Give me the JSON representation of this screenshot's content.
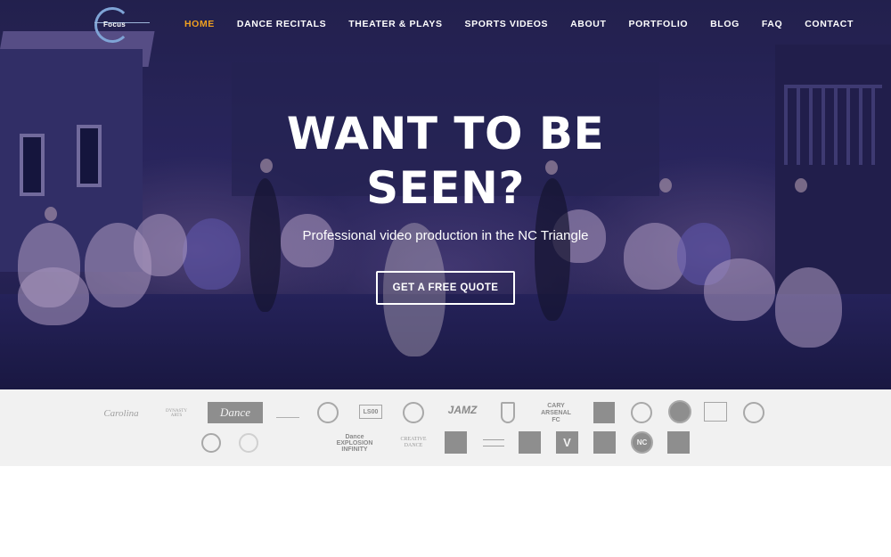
{
  "nav": {
    "logo_word": "Focus",
    "items": [
      {
        "label": "HOME",
        "active": true
      },
      {
        "label": "DANCE RECITALS",
        "active": false
      },
      {
        "label": "THEATER & PLAYS",
        "active": false
      },
      {
        "label": "SPORTS VIDEOS",
        "active": false
      },
      {
        "label": "ABOUT",
        "active": false
      },
      {
        "label": "PORTFOLIO",
        "active": false
      },
      {
        "label": "BLOG",
        "active": false
      },
      {
        "label": "FAQ",
        "active": false
      },
      {
        "label": "CONTACT",
        "active": false
      }
    ],
    "active_color": "#f0a020"
  },
  "hero": {
    "title_line1": "WANT TO BE",
    "title_line2": "SEEN?",
    "subtitle": "Professional video production in the NC Triangle",
    "cta_label": "GET A FREE QUOTE"
  },
  "clients": {
    "row1": [
      "Carolina",
      "DYNASTY ARTS",
      "Dance",
      "LS00",
      "JAMZ",
      "CARY",
      "ARSENAL",
      "FC"
    ],
    "row2": [
      "Dance",
      "EXPLOSION",
      "INFINITY",
      "CREATIVE",
      "DANCE",
      "V",
      "NC"
    ]
  }
}
